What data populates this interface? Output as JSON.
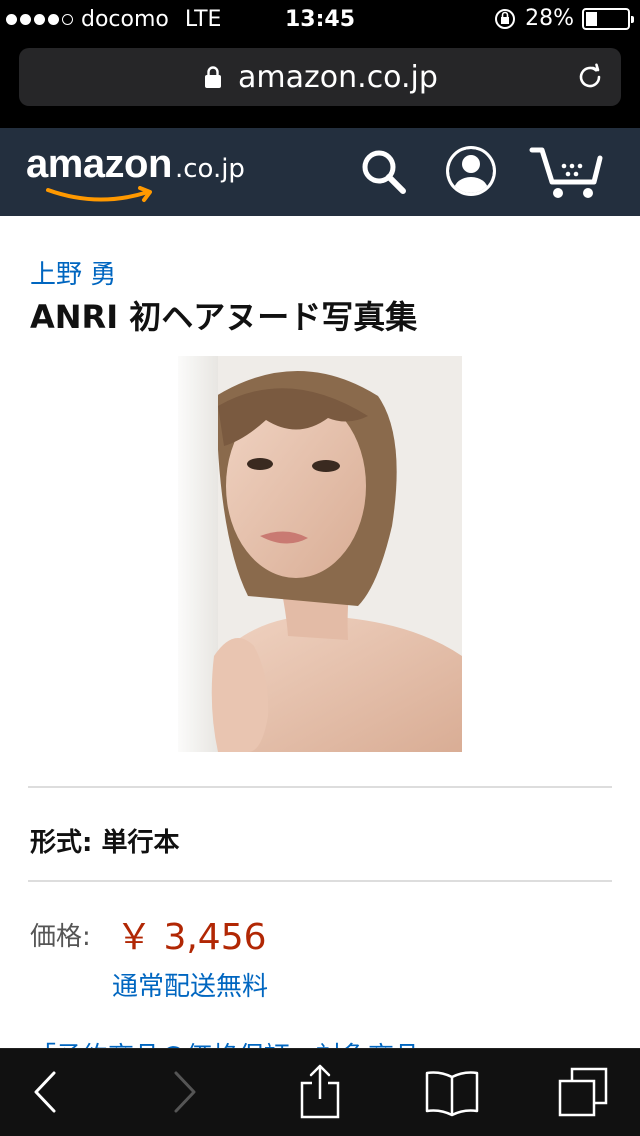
{
  "status_bar": {
    "carrier": "docomo",
    "network": "LTE",
    "time": "13:45",
    "battery": "28%",
    "battery_level": 0.28,
    "signal_bars": 4,
    "icons": [
      "orientation-lock-icon",
      "battery-icon"
    ]
  },
  "browser": {
    "url": "amazon.co.jp",
    "icons": [
      "lock-icon",
      "reload-icon"
    ]
  },
  "header": {
    "logo_word": "amazon",
    "logo_tld": ".co.jp",
    "icons": [
      "search-icon",
      "account-icon",
      "cart-icon"
    ]
  },
  "product": {
    "author": "上野 勇",
    "title": "ANRI 初ヘアヌード写真集",
    "format_label": "形式: 単行本",
    "price_label": "価格:",
    "price": "￥ 3,456",
    "shipping": "通常配送無料",
    "promo": "「予約商品の価格保証」対象商品"
  },
  "colors": {
    "amazon_nav": "#232f3e",
    "link": "#0066c0",
    "price": "#b12704",
    "logo_smile": "#ff9900"
  },
  "toolbar": {
    "icons": [
      "back-icon",
      "forward-icon",
      "share-icon",
      "bookmarks-icon",
      "tabs-icon"
    ]
  }
}
